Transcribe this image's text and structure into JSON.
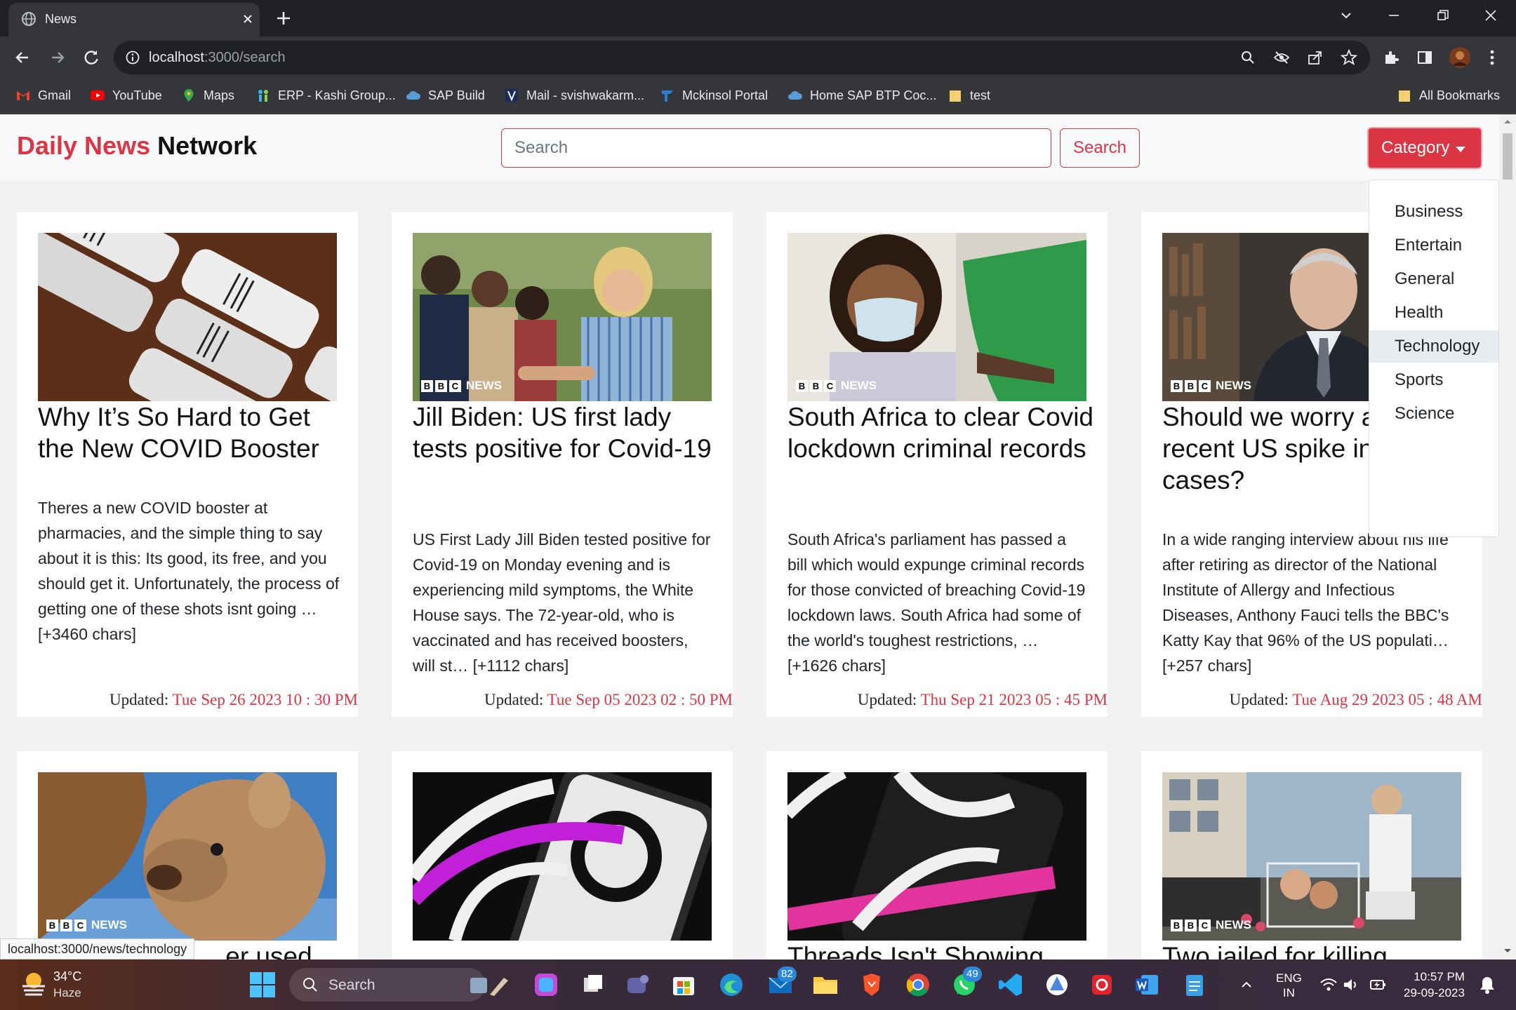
{
  "browser": {
    "tab_title": "News",
    "url_host": "localhost",
    "url_path": ":3000/search",
    "bookmarks": [
      {
        "label": "Gmail"
      },
      {
        "label": "YouTube"
      },
      {
        "label": "Maps"
      },
      {
        "label": "ERP - Kashi Group..."
      },
      {
        "label": "SAP Build"
      },
      {
        "label": "Mail - svishwakarm..."
      },
      {
        "label": "Mckinsol Portal"
      },
      {
        "label": "Home SAP BTP Coc..."
      },
      {
        "label": "test"
      },
      {
        "label": "All Bookmarks"
      }
    ]
  },
  "navbar": {
    "brand_red": "Daily News",
    "brand_dark": " Network",
    "search_placeholder": "Search",
    "search_button": "Search",
    "category_button": "Category"
  },
  "categories": [
    {
      "label": "Business"
    },
    {
      "label": "Entertain"
    },
    {
      "label": "General"
    },
    {
      "label": "Health"
    },
    {
      "label": "Technology"
    },
    {
      "label": "Sports"
    },
    {
      "label": "Science"
    }
  ],
  "updated_label": "Updated: ",
  "cards": [
    {
      "title": "Why It’s So Hard to Get the New COVID Booster",
      "description": "Theres a new COVID booster at pharmacies, and the simple thing to say about it is this: Its good, its free, and you should get it. Unfortunately, the process of getting one of these shots isnt going … [+3460 chars]",
      "date": "Tue Sep 26 2023 10 : 30 PM",
      "source_logo": ""
    },
    {
      "title": "Jill Biden: US first lady tests positive for Covid-19",
      "description": "US First Lady Jill Biden tested positive for Covid-19 on Monday evening and is experiencing mild symptoms, the White House says. The 72-year-old, who is vaccinated and has received boosters, will st… [+1112 chars]",
      "date": "Tue Sep 05 2023 02 : 50 PM",
      "source_logo": "NEWS"
    },
    {
      "title": "South Africa to clear Covid lockdown criminal records",
      "description": "South Africa's parliament has passed a bill which would expunge criminal records for those convicted of breaching Covid-19 lockdown laws. South Africa had some of the world's toughest restrictions, … [+1626 chars]",
      "date": "Thu Sep 21 2023 05 : 45 PM",
      "source_logo": "NEWS"
    },
    {
      "title": "Should we worry about recent US spike in Covid cases?",
      "description": "In a wide ranging interview about his life after retiring as director of the National Institute of Allergy and Infectious Diseases, Anthony Fauci tells the BBC's Katty Kay that 96% of the US populati… [+257 chars]",
      "date": "Tue Aug 29 2023 05 : 48 AM",
      "source_logo": "NEWS"
    },
    {
      "title": "… er used",
      "source_logo": "NEWS"
    },
    {
      "title": "",
      "source_logo": ""
    },
    {
      "title": "Threads Isn't Showing",
      "source_logo": ""
    },
    {
      "title": "Two jailed for killing",
      "source_logo": "NEWS"
    }
  ],
  "status_url": "localhost:3000/news/technology",
  "taskbar": {
    "temperature": "34°C",
    "weather": "Haze",
    "search_label": "Search",
    "badge_mail": "82",
    "badge_whatsapp": "49",
    "lang_1": "ENG",
    "lang_2": "IN",
    "time": "10:57 PM",
    "date": "29-09-2023"
  },
  "colors": {
    "accent": "#dc3545"
  }
}
